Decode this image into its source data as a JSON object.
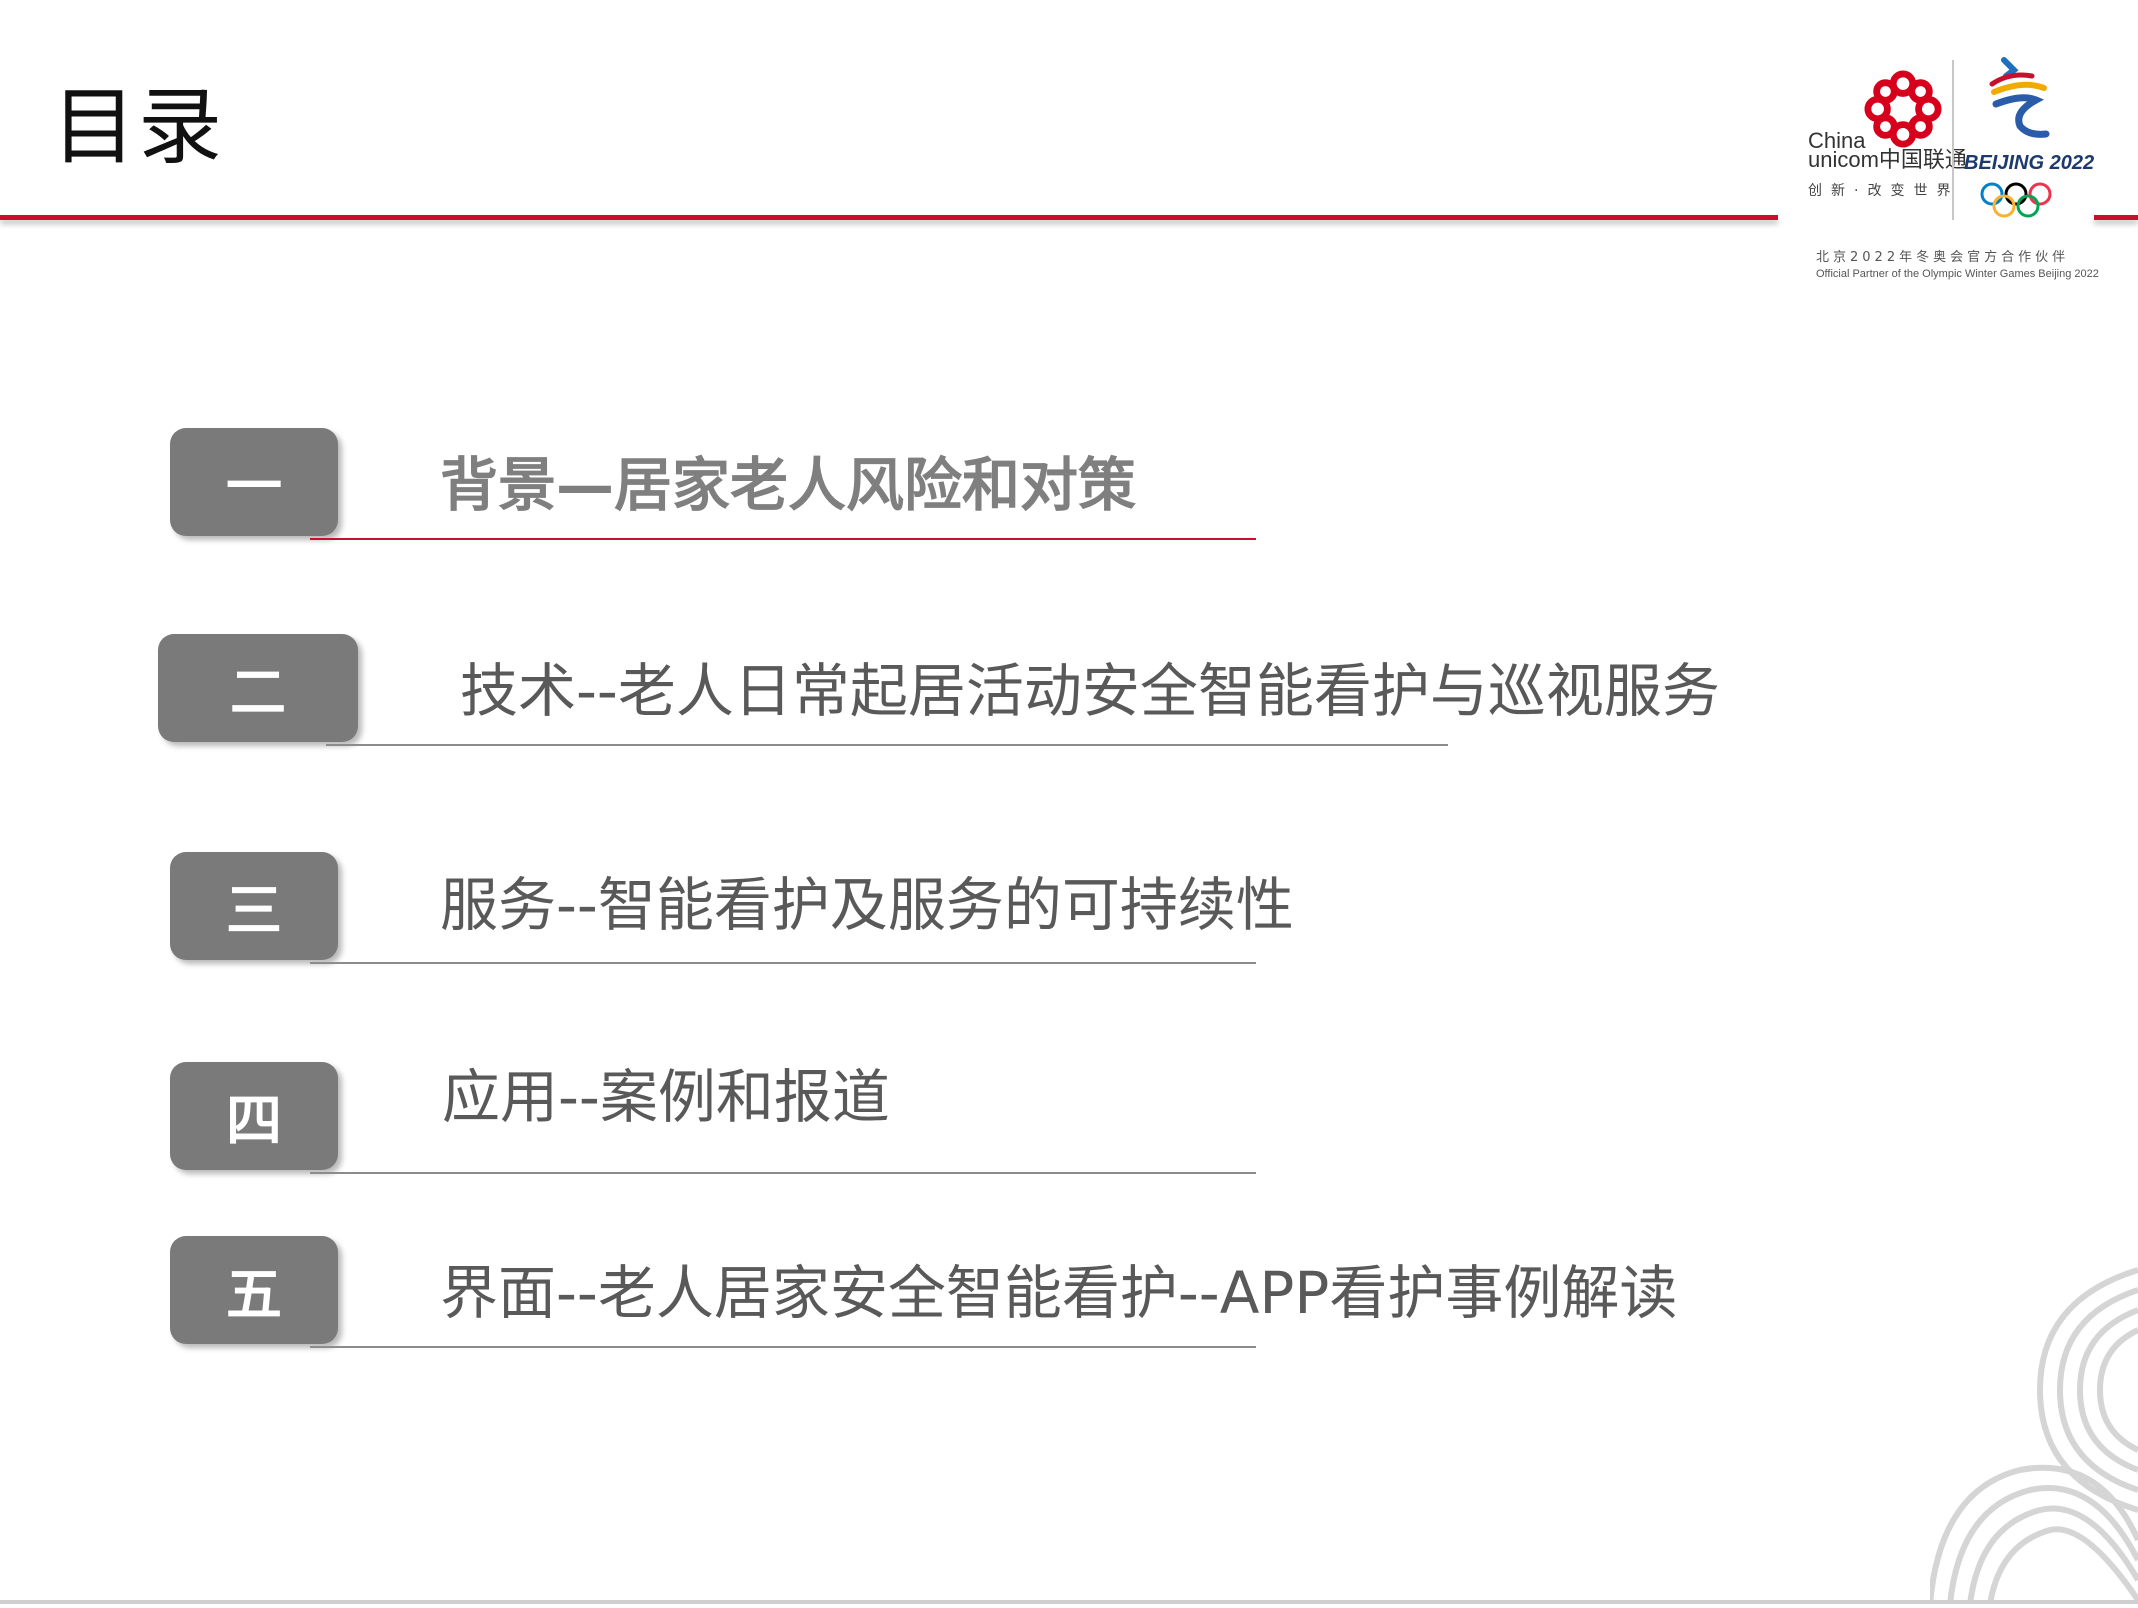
{
  "header": {
    "title": "目录"
  },
  "logo": {
    "unicom_en_line1": "China",
    "unicom_en_line2": "unicom中国联通",
    "unicom_slogan": "创新·改变世界",
    "beijing_text": "BEIJING 2022",
    "partner_cn": "北京2022年冬奥会官方合作伙伴",
    "partner_en": "Official Partner of the Olympic Winter Games Beijing 2022"
  },
  "toc": {
    "items": [
      {
        "number": "一",
        "title": "背景—居家老人风险和对策"
      },
      {
        "number": "二",
        "title": "技术--老人日常起居活动安全智能看护与巡视服务"
      },
      {
        "number": "三",
        "title": "服务--智能看护及服务的可持续性"
      },
      {
        "number": "四",
        "title": "应用--案例和报道"
      },
      {
        "number": "五",
        "title": "界面--老人居家安全智能看护--APP看护事例解读"
      }
    ]
  },
  "colors": {
    "accent_red": "#c8102e",
    "badge_gray": "#7a7a7a",
    "text_gray": "#595959"
  }
}
